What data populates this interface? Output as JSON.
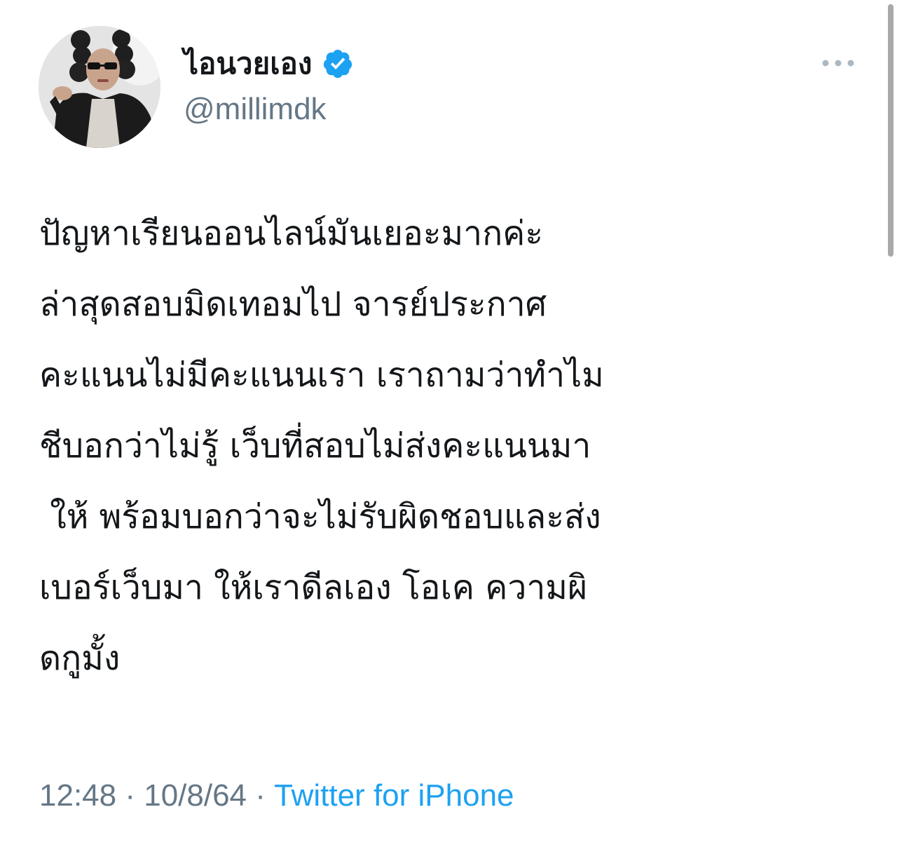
{
  "tweet": {
    "author": {
      "display_name": "ไอนวยเอง",
      "handle": "@millimdk",
      "verified": true,
      "avatar_icon": "profile-photo"
    },
    "text_lines": [
      "ปัญหาเรียนออนไลน์มันเยอะมากค่ะ",
      "ล่าสุดสอบมิดเทอมไป จารย์ประกาศ",
      "คะแนนไม่มีคะแนนเรา เราถามว่าทำไม",
      "ชีบอกว่าไม่รู้ เว็บที่สอบไม่ส่งคะแนนมา",
      " ให้ พร้อมบอกว่าจะไม่รับผิดชอบและส่ง",
      "เบอร์เว็บมา ให้เราดีลเอง โอเค ความผิ",
      "ดกูมั้ง"
    ],
    "time": "12:48",
    "separator": " · ",
    "date": "10/8/64",
    "source": "Twitter for iPhone"
  },
  "icons": {
    "verified": "verified-badge-icon",
    "more": "more-options-icon"
  },
  "colors": {
    "text_primary": "#14171a",
    "text_secondary": "#657786",
    "accent": "#1da1f2"
  }
}
